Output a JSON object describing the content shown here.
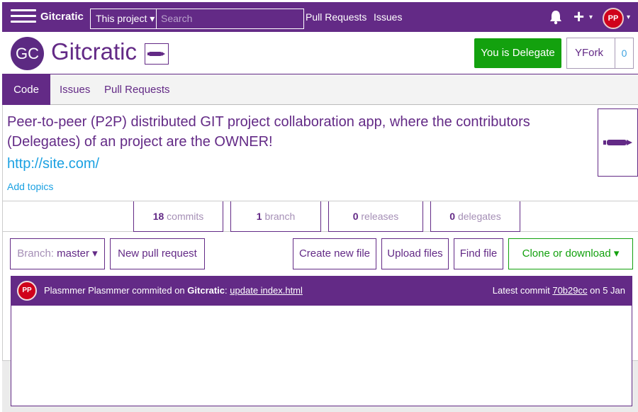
{
  "navbar": {
    "brand": "Gitcratic",
    "scope_label": "This project ▾",
    "search_placeholder": "Search",
    "links": [
      "Pull Requests",
      "Issues"
    ],
    "user_initials": "PP",
    "menu_caret": "▾",
    "plus_symbol": "+"
  },
  "project": {
    "logo_initials": "GC",
    "name": "Gitcratic",
    "delegate_button": "You is Delegate",
    "fork_label": "Fork",
    "fork_count": "0"
  },
  "tabs": [
    "Code",
    "Issues",
    "Pull Requests"
  ],
  "description": {
    "text": "Peer-to-peer (P2P) distributed GIT project collaboration app, where the contributors (Delegates) of an project are the OWNER!",
    "link": "http://site.com/",
    "topics_link": "Add topics"
  },
  "stats": [
    {
      "count": "18",
      "label": "commits"
    },
    {
      "count": "1",
      "label": "branch"
    },
    {
      "count": "0",
      "label": "releases"
    },
    {
      "count": "0",
      "label": "delegates"
    }
  ],
  "actions": {
    "branch_prefix": "Branch:",
    "branch_value": "master ▾",
    "new_pr": "New pull request",
    "create_file": "Create new file",
    "upload_files": "Upload files",
    "find_file": "Find file",
    "clone": "Clone or download ▾"
  },
  "commit": {
    "avatar_initials": "PP",
    "author_text": "Plasmmer Plasmmer commited on",
    "project": "Gitcratic",
    "separator": ":",
    "message": "update index.html",
    "latest_label": "Latest commit",
    "hash": "70b29cc",
    "date": "on 5 Jan"
  },
  "colors": {
    "brand_purple": "#632a86",
    "delegate_green": "#13a10e",
    "link_blue": "#1ba1e2",
    "avatar_red": "#d0021b"
  },
  "icons": [
    "hamburger-icon",
    "bell-icon",
    "plus-icon",
    "pen-icon",
    "fork-icon"
  ]
}
